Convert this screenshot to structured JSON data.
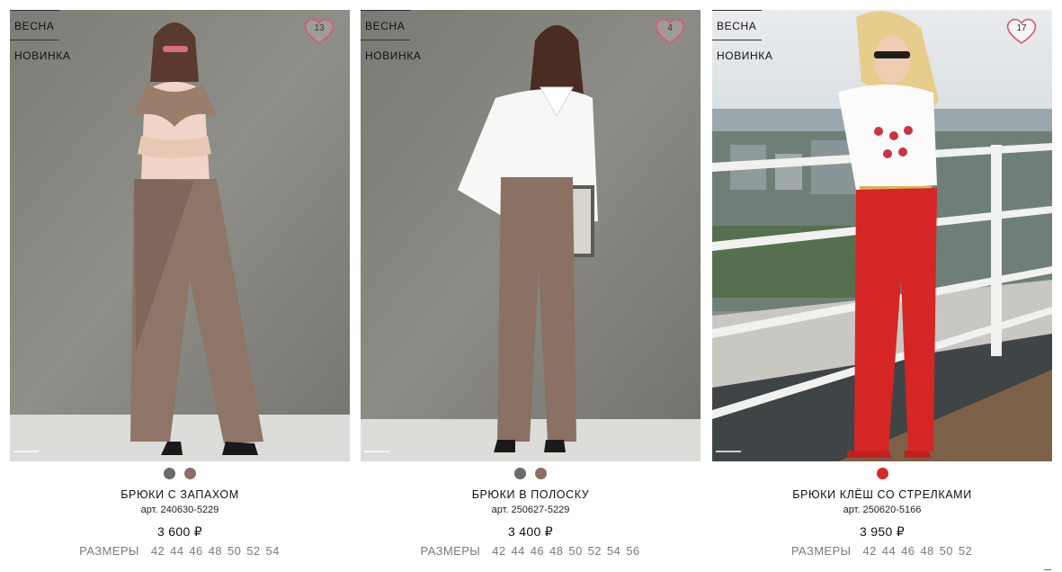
{
  "products": [
    {
      "badges": [
        "ВЕСНА",
        "НОВИНКА"
      ],
      "favorites": "13",
      "colors": [
        "#6b6b6b",
        "#8e6f64"
      ],
      "name": "БРЮКИ С ЗАПАХОМ",
      "sku": "арт. 240630-5229",
      "price": "3 600 ₽",
      "sizes_label": "РАЗМЕРЫ",
      "sizes": [
        "42",
        "44",
        "46",
        "48",
        "50",
        "52",
        "54"
      ]
    },
    {
      "badges": [
        "ВЕСНА",
        "НОВИНКА"
      ],
      "favorites": "4",
      "colors": [
        "#6b6b6b",
        "#8e6f64"
      ],
      "name": "БРЮКИ В ПОЛОСКУ",
      "sku": "арт. 250627-5229",
      "price": "3 400 ₽",
      "sizes_label": "РАЗМЕРЫ",
      "sizes": [
        "42",
        "44",
        "46",
        "48",
        "50",
        "52",
        "54",
        "56"
      ]
    },
    {
      "badges": [
        "ВЕСНА",
        "НОВИНКА"
      ],
      "favorites": "17",
      "colors": [
        "#d42a2a"
      ],
      "name": "БРЮКИ КЛЁШ СО СТРЕЛКАМИ",
      "sku": "арт. 250620-5166",
      "price": "3 950 ₽",
      "sizes_label": "РАЗМЕРЫ",
      "sizes": [
        "42",
        "44",
        "46",
        "48",
        "50",
        "52"
      ]
    }
  ],
  "icons": {
    "favorite": "heart-icon"
  },
  "theme": {
    "heart_stroke": "#e0566a",
    "text_muted": "#7a7a7a"
  }
}
